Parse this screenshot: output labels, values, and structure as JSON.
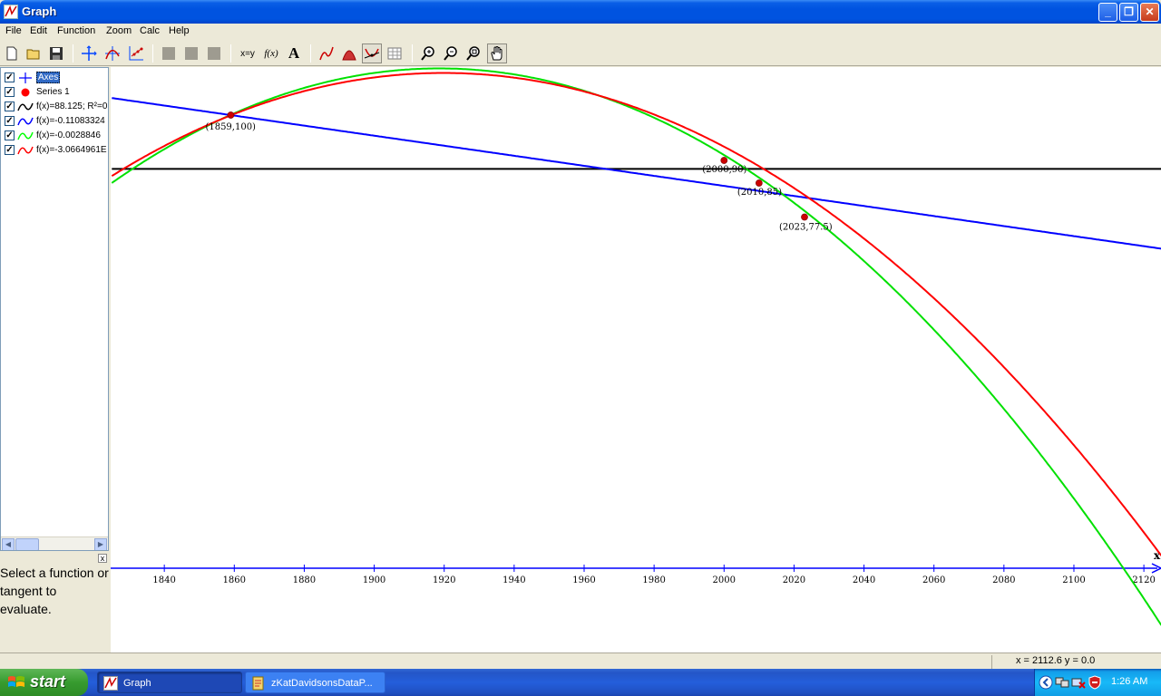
{
  "window": {
    "title": "Graph"
  },
  "title_buttons": {
    "minimize": "_",
    "maximize": "❐",
    "close": "✕"
  },
  "menu": [
    "File",
    "Edit",
    "Function",
    "Zoom",
    "Calc",
    "Help"
  ],
  "toolbar_icons": [
    "new-icon",
    "open-icon",
    "save-icon",
    "axes-icon",
    "insert-function-icon",
    "insert-point-series-icon",
    "disabled-icon",
    "disabled-icon",
    "disabled-icon",
    "evaluate-xy-icon",
    "insert-label-fx-icon",
    "insert-text-icon",
    "trendline-icon",
    "shade-icon",
    "tangent-icon",
    "table-icon",
    "zoom-in-icon",
    "zoom-out-icon",
    "zoom-fit-icon",
    "move-hand-icon"
  ],
  "toolbar_text": {
    "evaluate": "x=y",
    "fx": "f(x)",
    "text": "A"
  },
  "function_list": [
    {
      "label": "Axes",
      "checked": true,
      "icon": "axes",
      "color": "#0000ff",
      "selected": true
    },
    {
      "label": "Series 1",
      "checked": true,
      "icon": "point",
      "color": "#ff0000"
    },
    {
      "label": "f(x)=88.125; R²=0",
      "checked": true,
      "icon": "curve",
      "color": "#000000"
    },
    {
      "label": "f(x)=-0.11083324",
      "checked": true,
      "icon": "curve",
      "color": "#0000ff"
    },
    {
      "label": "f(x)=-0.0028846",
      "checked": true,
      "icon": "curve",
      "color": "#00ff00"
    },
    {
      "label": "f(x)=-3.0664961E",
      "checked": true,
      "icon": "curve",
      "color": "#ff0000"
    }
  ],
  "check_mark": "✓",
  "scroll": {
    "left": "◀",
    "right": "▶"
  },
  "splitter_close": "x",
  "eval_hint": "Select a function or tangent to evaluate.",
  "status": {
    "coords": "x = 2112.6    y = 0.0"
  },
  "taskbar": {
    "start": "start",
    "tasks": [
      {
        "label": "Graph",
        "active": true
      },
      {
        "label": "zKatDavidsonsDataP..."
      }
    ],
    "time": "1:26 AM"
  },
  "chart_data": {
    "type": "scatter",
    "x_axis_label": "x",
    "xlim": [
      1825,
      2125
    ],
    "ylim": [
      -28,
      128
    ],
    "x_ticks": [
      1840,
      1860,
      1880,
      1900,
      1920,
      1940,
      1960,
      1980,
      2000,
      2020,
      2040,
      2060,
      2080,
      2100,
      2120
    ],
    "points": [
      {
        "x": 1859,
        "y": 100,
        "label": "(1859,100)"
      },
      {
        "x": 2000,
        "y": 90,
        "label": "(2000,90)"
      },
      {
        "x": 2010,
        "y": 85,
        "label": "(2010,85)"
      },
      {
        "x": 2023,
        "y": 77.5,
        "label": "(2023,77.5)"
      }
    ],
    "point_color": "#cc0000",
    "series": [
      {
        "name": "f(x)=88.125; R²=0",
        "kind": "constant",
        "value": 88.125,
        "color": "#000000"
      },
      {
        "name": "f(x)=-0.11083324",
        "kind": "linear",
        "slope": -0.11083324,
        "through": [
          1859,
          100
        ],
        "color": "#0000ff"
      },
      {
        "name": "f(x)=-0.0028846",
        "kind": "quadratic",
        "a": -0.0028846,
        "vertex_x": 1918.6,
        "vertex_y": 110.3,
        "color": "#00e000"
      },
      {
        "name": "f(x)=-3.0664961E",
        "kind": "quadratic",
        "a": -0.00253,
        "vertex_x": 1919.8,
        "vertex_y": 109.3,
        "color": "#ff0000"
      }
    ],
    "grid": false
  }
}
